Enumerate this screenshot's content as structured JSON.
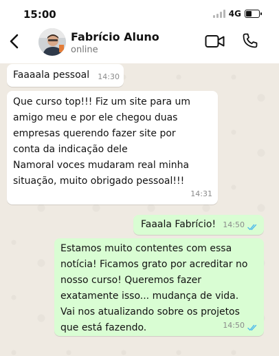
{
  "status_bar": {
    "time": "15:00",
    "network": "4G"
  },
  "header": {
    "contact_name": "Fabrício Aluno",
    "contact_status": "online"
  },
  "icons": {
    "back": "arrow-left-icon",
    "video": "video-call-icon",
    "call": "phone-icon",
    "read_receipt": "double-check-icon"
  },
  "colors": {
    "incoming_bubble": "#ffffff",
    "outgoing_bubble": "#d9fdd3",
    "read_ticks": "#53bdeb",
    "chat_background": "#efeae2"
  },
  "messages": [
    {
      "direction": "incoming",
      "text": "Faaaala pessoal",
      "time": "14:30"
    },
    {
      "direction": "incoming",
      "text": "Que curso top!!! Fiz um site para um\namigo meu e por ele chegou duas\nempresas querendo fazer site por\nconta da indicação dele\nNamoral voces mudaram real minha\nsituação, muito obrigado pessoal!!!",
      "time": "14:31"
    },
    {
      "direction": "outgoing",
      "text": "Faaala Fabrício!",
      "time": "14:50",
      "read": true
    },
    {
      "direction": "outgoing",
      "text": "Estamos muito contentes com essa\nnotícia! Ficamos grato por acreditar no\nnosso curso! Queremos fazer\nexatamente isso... mudança de vida.\nVai nos atualizando sobre os projetos\nque está fazendo.",
      "time": "14:50",
      "read": true
    }
  ]
}
